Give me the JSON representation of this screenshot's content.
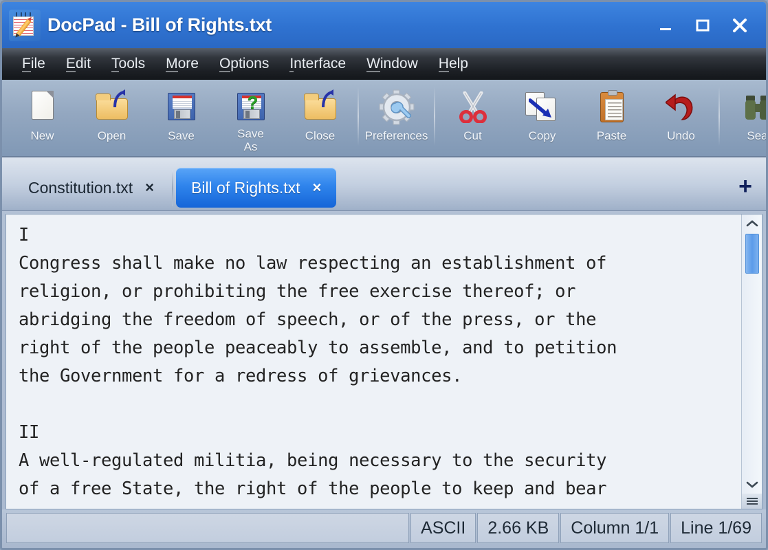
{
  "window": {
    "title": "DocPad - Bill of Rights.txt",
    "app_icon": "notepad-pencil-icon",
    "controls": {
      "minimize": "minimize-icon",
      "maximize": "maximize-icon",
      "close": "close-icon"
    }
  },
  "menubar": {
    "items": [
      {
        "label": "File",
        "mnemonic": "F",
        "rest": "ile"
      },
      {
        "label": "Edit",
        "mnemonic": "E",
        "rest": "dit"
      },
      {
        "label": "Tools",
        "mnemonic": "T",
        "rest": "ools"
      },
      {
        "label": "More",
        "mnemonic": "M",
        "rest": "ore"
      },
      {
        "label": "Options",
        "mnemonic": "O",
        "rest": "ptions"
      },
      {
        "label": "Interface",
        "mnemonic": "I",
        "rest": "nterface"
      },
      {
        "label": "Window",
        "mnemonic": "W",
        "rest": "indow"
      },
      {
        "label": "Help",
        "mnemonic": "H",
        "rest": "elp"
      }
    ]
  },
  "toolbar": {
    "buttons": [
      {
        "label": "New",
        "icon": "new-document-icon"
      },
      {
        "label": "Open",
        "icon": "open-folder-icon"
      },
      {
        "label": "Save",
        "icon": "floppy-disk-icon"
      },
      {
        "label": "Save\nAs",
        "label_line1": "Save",
        "label_line2": "As",
        "icon": "floppy-disk-question-icon"
      },
      {
        "label": "Close",
        "icon": "close-folder-icon"
      },
      {
        "label": "Preferences",
        "icon": "gear-wrench-icon"
      },
      {
        "label": "Cut",
        "icon": "scissors-icon"
      },
      {
        "label": "Copy",
        "icon": "copy-pages-icon"
      },
      {
        "label": "Paste",
        "icon": "clipboard-icon"
      },
      {
        "label": "Undo",
        "icon": "undo-arrow-icon"
      },
      {
        "label": "Sea",
        "icon": "binoculars-search-icon"
      }
    ]
  },
  "tabs": {
    "items": [
      {
        "label": "Constitution.txt",
        "active": false,
        "close": "×"
      },
      {
        "label": "Bill of Rights.txt",
        "active": true,
        "close": "×"
      }
    ],
    "add_label": "+"
  },
  "editor": {
    "content": "I\nCongress shall make no law respecting an establishment of\nreligion, or prohibiting the free exercise thereof; or\nabridging the freedom of speech, or of the press, or the\nright of the people peaceably to assemble, and to petition\nthe Government for a redress of grievances.\n\nII\nA well-regulated militia, being necessary to the security\nof a free State, the right of the people to keep and bear",
    "scrollbar": {
      "up": "⌃",
      "down": "⌄"
    }
  },
  "statusbar": {
    "message": "",
    "encoding": "ASCII",
    "filesize": "2.66 KB",
    "column": "Column 1/1",
    "line": "Line 1/69"
  },
  "colors": {
    "titlebar_blue": "#2f72d0",
    "active_tab_blue": "#1565d8",
    "menubar_dark": "#1c1f24",
    "toolbar_slate": "#93a7c0",
    "editor_bg": "#eef2f7",
    "scroll_thumb": "#5b9bea"
  }
}
